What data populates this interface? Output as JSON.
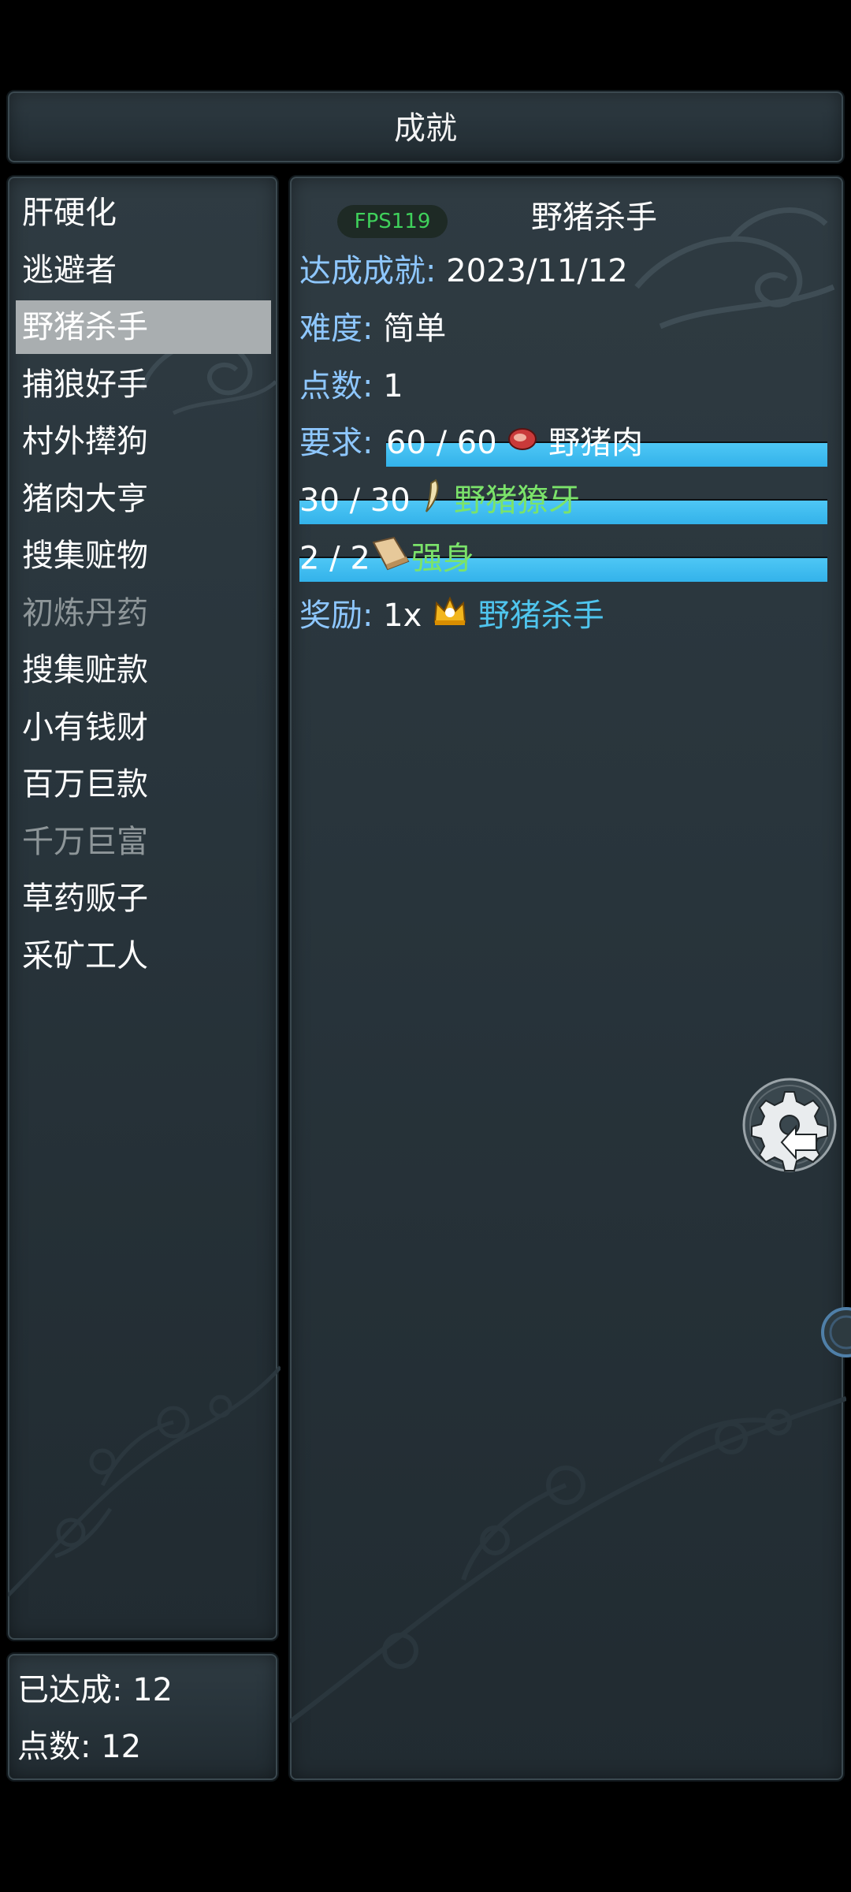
{
  "header": {
    "title": "成就"
  },
  "achievements": [
    {
      "label": "肝硬化",
      "state": "normal"
    },
    {
      "label": "逃避者",
      "state": "normal"
    },
    {
      "label": "野猪杀手",
      "state": "selected"
    },
    {
      "label": "捕狼好手",
      "state": "normal"
    },
    {
      "label": "村外撵狗",
      "state": "normal"
    },
    {
      "label": "猪肉大亨",
      "state": "normal"
    },
    {
      "label": "搜集赃物",
      "state": "normal"
    },
    {
      "label": "初炼丹药",
      "state": "dim"
    },
    {
      "label": "搜集赃款",
      "state": "normal"
    },
    {
      "label": "小有钱财",
      "state": "normal"
    },
    {
      "label": "百万巨款",
      "state": "normal"
    },
    {
      "label": "千万巨富",
      "state": "dim"
    },
    {
      "label": "草药贩子",
      "state": "normal"
    },
    {
      "label": "采矿工人",
      "state": "normal"
    }
  ],
  "stats": {
    "achieved": "已达成: 12",
    "points": "点数: 12"
  },
  "detail": {
    "fps": "FPS119",
    "title": "野猪杀手",
    "achieved_label": "达成成就:",
    "achieved_value": "2023/11/12",
    "difficulty_label": "难度:",
    "difficulty_value": "简单",
    "points_label": "点数:",
    "points_value": "1",
    "requirements_label": "要求:",
    "requirements": [
      {
        "count": "60 / 60",
        "item": "野猪肉",
        "icon": "meat-icon",
        "item_color": "white",
        "progress": 1.0
      },
      {
        "count": "30 / 30",
        "item": "野猪獠牙",
        "icon": "tusk-icon",
        "item_color": "green",
        "progress": 1.0
      },
      {
        "count": "2 / 2",
        "item": "强身",
        "icon": "book-icon",
        "item_color": "green",
        "progress": 1.0
      }
    ],
    "reward_label": "奖励:",
    "reward_count": "1x",
    "reward_icon": "crown-icon",
    "reward_item": "野猪杀手"
  },
  "colors": {
    "label_blue": "#8ec7ff",
    "item_green": "#7be36a",
    "reward_cyan": "#4fc5ee",
    "progress_blue": "#3db8ee",
    "selected_bg": "#a9aeb0",
    "dim_text": "#8e9699"
  }
}
